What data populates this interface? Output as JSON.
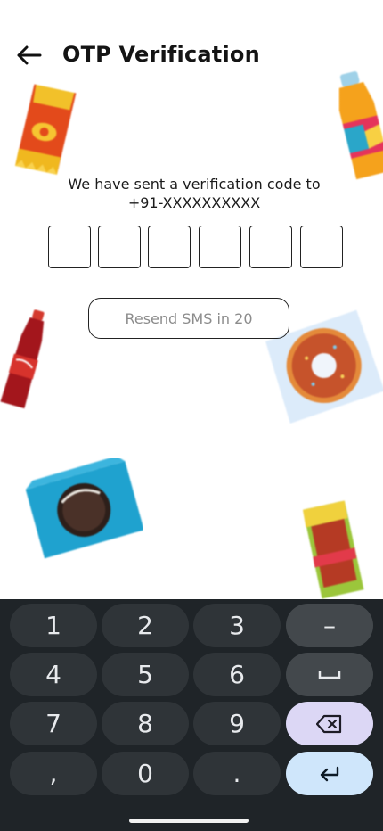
{
  "header": {
    "title": "OTP Verification",
    "back_icon": "arrow-left-icon"
  },
  "message": {
    "line1": "We have sent a verification code to",
    "phone": "+91-XXXXXXXXXX"
  },
  "otp": {
    "digits": [
      "",
      "",
      "",
      "",
      "",
      ""
    ]
  },
  "resend": {
    "label": "Resend SMS in 20"
  },
  "keyboard": {
    "rows": [
      [
        "1",
        "2",
        "3",
        "–"
      ],
      [
        "4",
        "5",
        "6",
        "␣"
      ],
      [
        "7",
        "8",
        "9",
        "⌫"
      ],
      [
        ",",
        "0",
        ".",
        "↵"
      ]
    ]
  },
  "colors": {
    "keyboard_bg": "#1f2428",
    "key_bg": "#2f3438",
    "backspace_bg": "#dcd7f5",
    "enter_bg": "#cfe6fb"
  }
}
